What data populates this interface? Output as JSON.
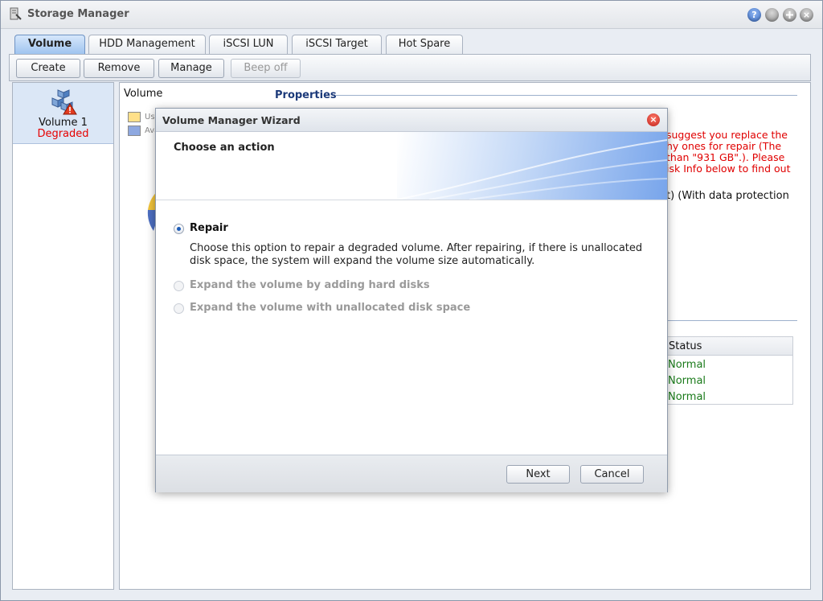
{
  "window": {
    "title": "Storage Manager",
    "help": "?",
    "close": "×"
  },
  "tabs": [
    "Volume",
    "HDD Management",
    "iSCSI LUN",
    "iSCSI Target",
    "Hot Spare"
  ],
  "toolbar": {
    "create": "Create",
    "remove": "Remove",
    "manage": "Manage",
    "beep_off": "Beep off"
  },
  "volume_list": [
    {
      "name": "Volume 1",
      "status": "Degraded"
    }
  ],
  "main": {
    "volume_header": "Volume",
    "properties_title": "Properties",
    "legend": [
      {
        "label": "Us",
        "color": "#ffe08a"
      },
      {
        "label": "Ava",
        "color": "#8ea8e0"
      }
    ],
    "warning": "suggest you replace the\nhy ones for repair (The\nthan \"931 GB\".). Please\nisk Info below to find out",
    "protection": "t) (With data protection",
    "disk_table": {
      "header": "Status",
      "rows": [
        "Normal",
        "Normal",
        "Normal"
      ]
    }
  },
  "dialog": {
    "title": "Volume Manager Wizard",
    "heading": "Choose an action",
    "options": [
      {
        "label": "Repair",
        "checked": true,
        "enabled": true
      },
      {
        "label": "Expand the volume by adding hard disks",
        "checked": false,
        "enabled": false
      },
      {
        "label": "Expand the volume with unallocated disk space",
        "checked": false,
        "enabled": false
      }
    ],
    "repair_description": "Choose this option to repair a degraded volume. After repairing, if there is unallocated disk space, the system will expand the volume size automatically.",
    "buttons": {
      "next": "Next",
      "cancel": "Cancel"
    },
    "colors": {
      "accent": "#1e5db8",
      "close": "#c0201a"
    }
  }
}
